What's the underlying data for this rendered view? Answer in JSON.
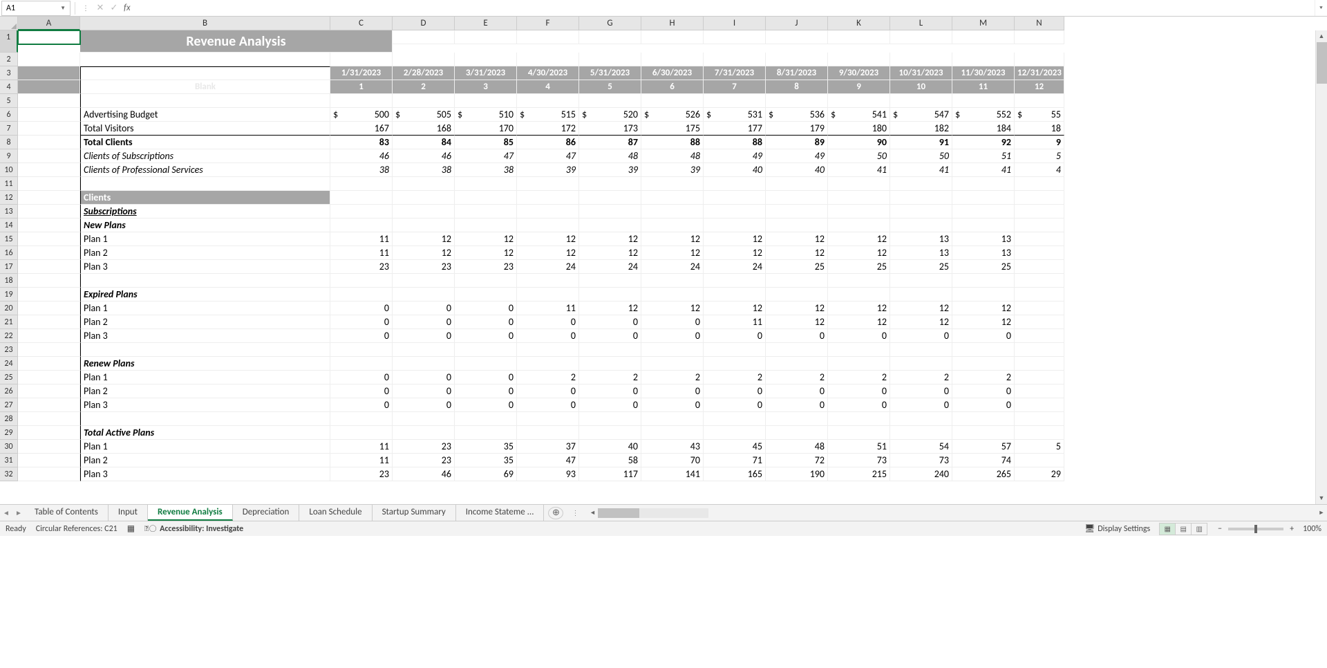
{
  "nameBox": "A1",
  "formulaValue": "",
  "title": "Revenue Analysis",
  "columns": [
    "A",
    "B",
    "C",
    "D",
    "E",
    "F",
    "G",
    "H",
    "I",
    "J",
    "K",
    "L",
    "M",
    "N"
  ],
  "colWidths": {
    "A": 90,
    "B": 362,
    "C": 90,
    "D": 90,
    "E": 90,
    "F": 90,
    "G": 90,
    "H": 90,
    "I": 90,
    "J": 90,
    "K": 90,
    "L": 90,
    "M": 90,
    "N": 72
  },
  "rowCount": 32,
  "dates": [
    "1/31/2023",
    "2/28/2023",
    "3/31/2023",
    "4/30/2023",
    "5/31/2023",
    "6/30/2023",
    "7/31/2023",
    "8/31/2023",
    "9/30/2023",
    "10/31/2023",
    "11/30/2023",
    "12/31/2023"
  ],
  "periods": [
    "1",
    "2",
    "3",
    "4",
    "5",
    "6",
    "7",
    "8",
    "9",
    "10",
    "11",
    "12"
  ],
  "blankLabel": "Blank",
  "labels": {
    "advBudget": "Advertising Budget",
    "totalVisitors": "Total Visitors",
    "totalClients": "Total Clients",
    "clientsSubs": "Clients of Subscriptions",
    "clientsProf": "Clients of Professional Services",
    "clients": "Clients",
    "subscriptions": "Subscriptions",
    "newPlans": "New Plans",
    "expiredPlans": "Expired Plans",
    "renewPlans": "Renew Plans",
    "totalActive": "Total Active Plans",
    "plan1": "Plan 1",
    "plan2": "Plan 2",
    "plan3": "Plan 3"
  },
  "data": {
    "advBudget": [
      "500",
      "505",
      "510",
      "515",
      "520",
      "526",
      "531",
      "536",
      "541",
      "547",
      "552",
      "55"
    ],
    "totalVisitors": [
      "167",
      "168",
      "170",
      "172",
      "173",
      "175",
      "177",
      "179",
      "180",
      "182",
      "184",
      "18"
    ],
    "totalClients": [
      "83",
      "84",
      "85",
      "86",
      "87",
      "88",
      "88",
      "89",
      "90",
      "91",
      "92",
      "9"
    ],
    "clientsSubs": [
      "46",
      "46",
      "47",
      "47",
      "48",
      "48",
      "49",
      "49",
      "50",
      "50",
      "51",
      "5"
    ],
    "clientsProf": [
      "38",
      "38",
      "38",
      "39",
      "39",
      "39",
      "40",
      "40",
      "41",
      "41",
      "41",
      "4"
    ],
    "newPlan1": [
      "11",
      "12",
      "12",
      "12",
      "12",
      "12",
      "12",
      "12",
      "12",
      "13",
      "13",
      ""
    ],
    "newPlan2": [
      "11",
      "12",
      "12",
      "12",
      "12",
      "12",
      "12",
      "12",
      "12",
      "13",
      "13",
      ""
    ],
    "newPlan3": [
      "23",
      "23",
      "23",
      "24",
      "24",
      "24",
      "24",
      "25",
      "25",
      "25",
      "25",
      ""
    ],
    "expPlan1": [
      "0",
      "0",
      "0",
      "11",
      "12",
      "12",
      "12",
      "12",
      "12",
      "12",
      "12",
      ""
    ],
    "expPlan2": [
      "0",
      "0",
      "0",
      "0",
      "0",
      "0",
      "11",
      "12",
      "12",
      "12",
      "12",
      ""
    ],
    "expPlan3": [
      "0",
      "0",
      "0",
      "0",
      "0",
      "0",
      "0",
      "0",
      "0",
      "0",
      "0",
      ""
    ],
    "renPlan1": [
      "0",
      "0",
      "0",
      "2",
      "2",
      "2",
      "2",
      "2",
      "2",
      "2",
      "2",
      ""
    ],
    "renPlan2": [
      "0",
      "0",
      "0",
      "0",
      "0",
      "0",
      "0",
      "0",
      "0",
      "0",
      "0",
      ""
    ],
    "renPlan3": [
      "0",
      "0",
      "0",
      "0",
      "0",
      "0",
      "0",
      "0",
      "0",
      "0",
      "0",
      ""
    ],
    "actPlan1": [
      "11",
      "23",
      "35",
      "37",
      "40",
      "43",
      "45",
      "48",
      "51",
      "54",
      "57",
      "5"
    ],
    "actPlan2": [
      "11",
      "23",
      "35",
      "47",
      "58",
      "70",
      "71",
      "72",
      "73",
      "73",
      "74",
      ""
    ],
    "actPlan3": [
      "23",
      "46",
      "69",
      "93",
      "117",
      "141",
      "165",
      "190",
      "215",
      "240",
      "265",
      "29"
    ]
  },
  "sheetTabs": [
    "Table of Contents",
    "Input",
    "Revenue Analysis",
    "Depreciation",
    "Loan Schedule",
    "Startup Summary",
    "Income Stateme ..."
  ],
  "activeTab": "Revenue Analysis",
  "status": {
    "ready": "Ready",
    "circular": "Circular References: C21",
    "accessibility": "Accessibility: Investigate",
    "displaySettings": "Display Settings",
    "zoom": "100%"
  }
}
